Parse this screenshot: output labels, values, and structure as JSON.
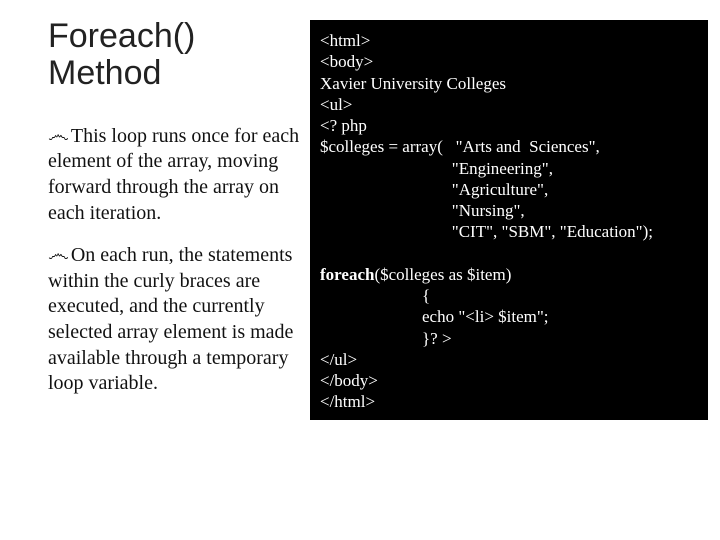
{
  "title": "Foreach() Method",
  "bullets": [
    "This loop runs once for each element of the array, moving forward through the array on each iteration.",
    "On each run, the statements within the curly braces are executed, and the currently selected array element is made available through a temporary loop variable."
  ],
  "bullet_marker": "෴",
  "code": {
    "l01": "<html>",
    "l02": "<body>",
    "l03": "Xavier University Colleges",
    "l04": "<ul>",
    "l05": "<? php",
    "l06": "$colleges = array(   \"Arts and  Sciences\",",
    "l07": "                               \"Engineering\",",
    "l08": "                               \"Agriculture\",",
    "l09": "                               \"Nursing\",",
    "l10": "                               \"CIT\", \"SBM\", \"Education\");",
    "l11": "",
    "fe_kw": "foreach",
    "fe_rest": "($colleges as $item)",
    "l13": "                        {",
    "l14": "                        echo \"<li> $item\";",
    "l15": "                        }? >",
    "l16": "</ul>",
    "l17": "</body>",
    "l18": "</html>"
  }
}
